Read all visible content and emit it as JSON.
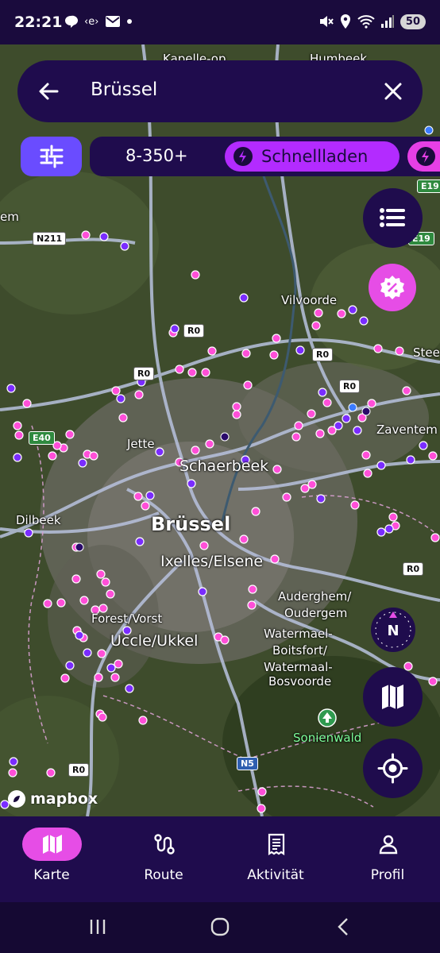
{
  "status_bar": {
    "time": "22:21",
    "battery": "50"
  },
  "search": {
    "query": "Brüssel"
  },
  "filters": {
    "power_range": "8-350+",
    "fast_label": "Schnellladen"
  },
  "map": {
    "places": {
      "bruessel": "Brüssel",
      "schaerbeek": "Schaerbeek",
      "ixelles": "Ixelles/Elsene",
      "uccle": "Uccle/Ukkel",
      "forest": "Forest/Vorst",
      "jette": "Jette",
      "dilbeek": "Dilbeek",
      "vilvoorde": "Vilvoorde",
      "zaventem": "Zaventem",
      "auderghem_1": "Auderghem/",
      "auderghem_2": "Oudergem",
      "watermael_1": "Watermael-",
      "watermael_2": "Boitsfort/",
      "watermael_3": "Watermaal-",
      "watermael_4": "Bosvoorde",
      "sonienwald": "Sonienwald",
      "steen_partial": "Stee",
      "em_partial": "em",
      "top_left_partial": "Kapelle-op",
      "top_right_partial": "Humbeek"
    },
    "roads": {
      "n211": "N211",
      "r0_a": "R0",
      "r0_b": "R0",
      "r0_c": "R0",
      "r0_d": "R0",
      "r0_e": "R0",
      "r0_f": "R0",
      "e40": "E40",
      "e19_a": "E19",
      "e19_b": "E19",
      "n5": "N5"
    },
    "attribution": "mapbox",
    "compass_label": "N"
  },
  "bottom_nav": [
    {
      "label": "Karte",
      "active": true
    },
    {
      "label": "Route",
      "active": false
    },
    {
      "label": "Aktivität",
      "active": false
    },
    {
      "label": "Profil",
      "active": false
    }
  ],
  "colors": {
    "dark_purple": "#1f0c4d",
    "accent_pink": "#e64de6",
    "accent_violet": "#b32bff",
    "accent_blue": "#6a4cff",
    "charger_pink": "#ff4fd8",
    "charger_purple": "#7a2cff"
  },
  "icons": [
    "back-arrow-icon",
    "close-icon",
    "sliders-icon",
    "lightning-icon",
    "list-icon",
    "percent-badge-icon",
    "compass-icon",
    "map-icon",
    "locate-icon",
    "route-icon",
    "receipt-icon",
    "person-icon"
  ]
}
